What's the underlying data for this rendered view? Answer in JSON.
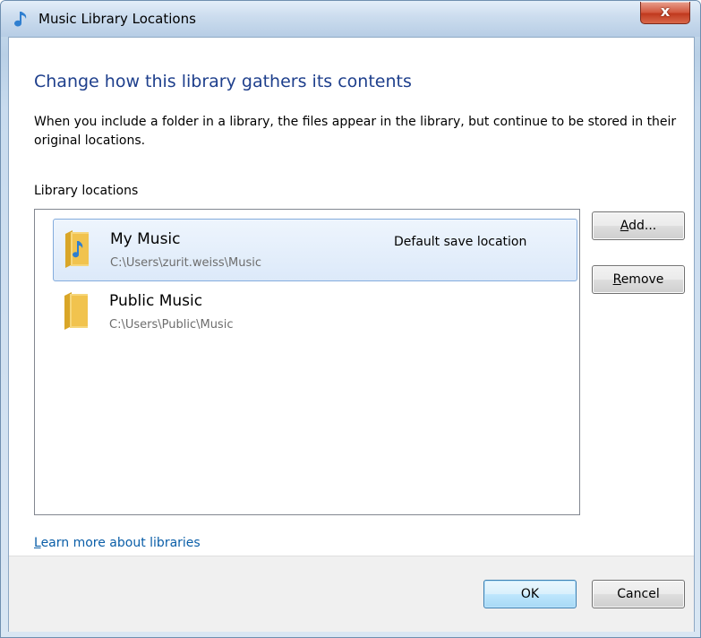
{
  "window": {
    "title": "Music Library Locations",
    "close_label": "x",
    "title_icon": "music-note-icon"
  },
  "dialog": {
    "heading": "Change how this library gathers its contents",
    "description": "When you include a folder in a library, the files appear in the library, but continue to be stored in their original locations.",
    "locations_label": "Library locations"
  },
  "locations": [
    {
      "name": "My Music",
      "path": "C:\\Users\\zurit.weiss\\Music",
      "note": "Default save location",
      "selected": true,
      "icon": "music-folder-icon"
    },
    {
      "name": "Public Music",
      "path": "C:\\Users\\Public\\Music",
      "note": "",
      "selected": false,
      "icon": "folder-icon"
    }
  ],
  "side_buttons": {
    "add_hotkey": "A",
    "add_rest": "dd...",
    "remove_hotkey": "R",
    "remove_rest": "emove"
  },
  "link": {
    "hotkey": "L",
    "rest": "earn more about libraries"
  },
  "footer": {
    "ok_label": "OK",
    "cancel_label": "Cancel"
  },
  "colors": {
    "heading": "#1e3f8c",
    "link": "#0a5ea8",
    "selection": "#dce9f9",
    "close_button": "#c0391e"
  }
}
